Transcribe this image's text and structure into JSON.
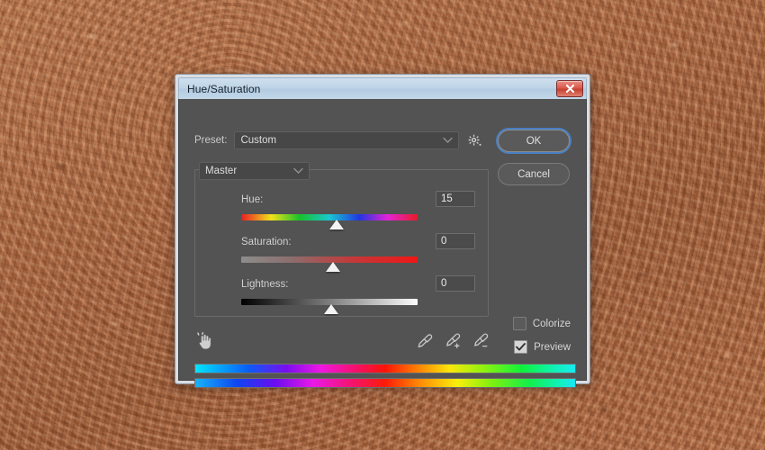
{
  "desktop": {
    "texture_color": "#a9673f",
    "description": "copper hammered metal texture"
  },
  "dialog": {
    "title": "Hue/Saturation",
    "close_icon": "close-x-icon",
    "preset": {
      "label": "Preset:",
      "value": "Custom",
      "chevron_icon": "chevron-down-icon",
      "gear_icon": "gear-icon"
    },
    "buttons": {
      "ok": "OK",
      "cancel": "Cancel"
    },
    "channel": {
      "value": "Master",
      "chevron_icon": "chevron-down-icon"
    },
    "sliders": [
      {
        "name": "hue",
        "label": "Hue:",
        "value": "15",
        "thumb_percent": 54
      },
      {
        "name": "saturation",
        "label": "Saturation:",
        "value": "0",
        "thumb_percent": 52
      },
      {
        "name": "lightness",
        "label": "Lightness:",
        "value": "0",
        "thumb_percent": 51
      }
    ],
    "checkboxes": [
      {
        "name": "colorize",
        "label": "Colorize",
        "checked": false
      },
      {
        "name": "preview",
        "label": "Preview",
        "checked": true
      }
    ],
    "tools": {
      "targeted_adjustment_icon": "hand-pointer-icon",
      "eyedropper_icons": [
        "eyedropper-icon",
        "eyedropper-add-icon",
        "eyedropper-subtract-icon"
      ]
    },
    "spectrum_bars": {
      "top_label": "original-hue-spectrum",
      "bottom_label": "adjusted-hue-spectrum"
    },
    "colors": {
      "titlebar": "#bdd3e6",
      "body": "#535353",
      "close_button": "#d95a4c",
      "focus_ring": "#4a7fc1",
      "text": "#d2d2d2"
    }
  }
}
